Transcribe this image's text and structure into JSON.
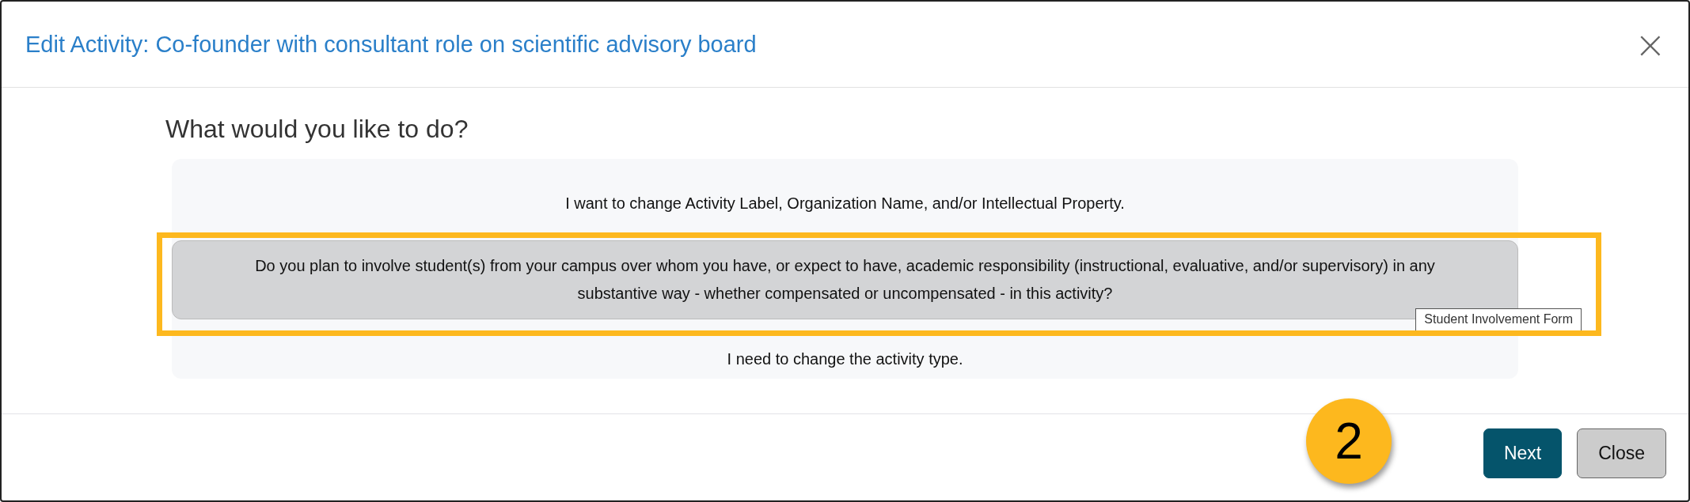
{
  "dialog": {
    "title": "Edit Activity: Co-founder with consultant role on scientific advisory board",
    "close_icon": "×"
  },
  "heading": "What would you like to do?",
  "options": [
    {
      "label": "I want to change Activity Label, Organization Name, and/or Intellectual Property.",
      "selected": false,
      "highlighted": false
    },
    {
      "label": "Do you plan to involve student(s) from your campus over whom you have, or expect to have, academic responsibility (instructional, evaluative, and/or supervisory) in any substantive way - whether compensated or uncompensated - in this activity?",
      "selected": true,
      "highlighted": true,
      "tooltip": "Student Involvement Form"
    },
    {
      "label": "I need to change the activity type.",
      "selected": false,
      "highlighted": false
    }
  ],
  "callout": {
    "number": "2"
  },
  "buttons": [
    {
      "label": "Next",
      "kind": "primary"
    },
    {
      "label": "Close",
      "kind": "secondary"
    }
  ]
}
